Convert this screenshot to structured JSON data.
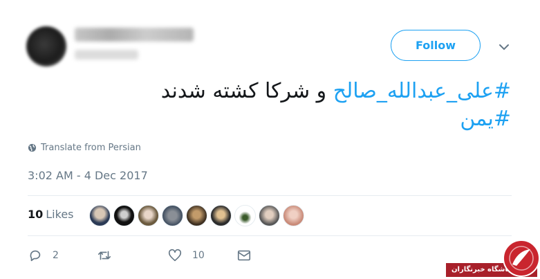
{
  "follow_label": "Follow",
  "tweet": {
    "line1_hashtag": "#علی_عبدالله_صالح",
    "line1_rest": " و شرکا کشته شدند",
    "line2_hashtag": "#یمن"
  },
  "translate_label": "Translate from Persian",
  "timestamp": "3:02 AM - 4 Dec 2017",
  "likes": {
    "count": "10",
    "label": "Likes"
  },
  "actions": {
    "reply_count": "2",
    "retweet_count": "",
    "like_count": "10"
  },
  "watermark_text": "باشگاه خبرنگاران",
  "colors": {
    "accent": "#1da1f2",
    "secondary": "#657786",
    "watermark": "#a8202a"
  }
}
